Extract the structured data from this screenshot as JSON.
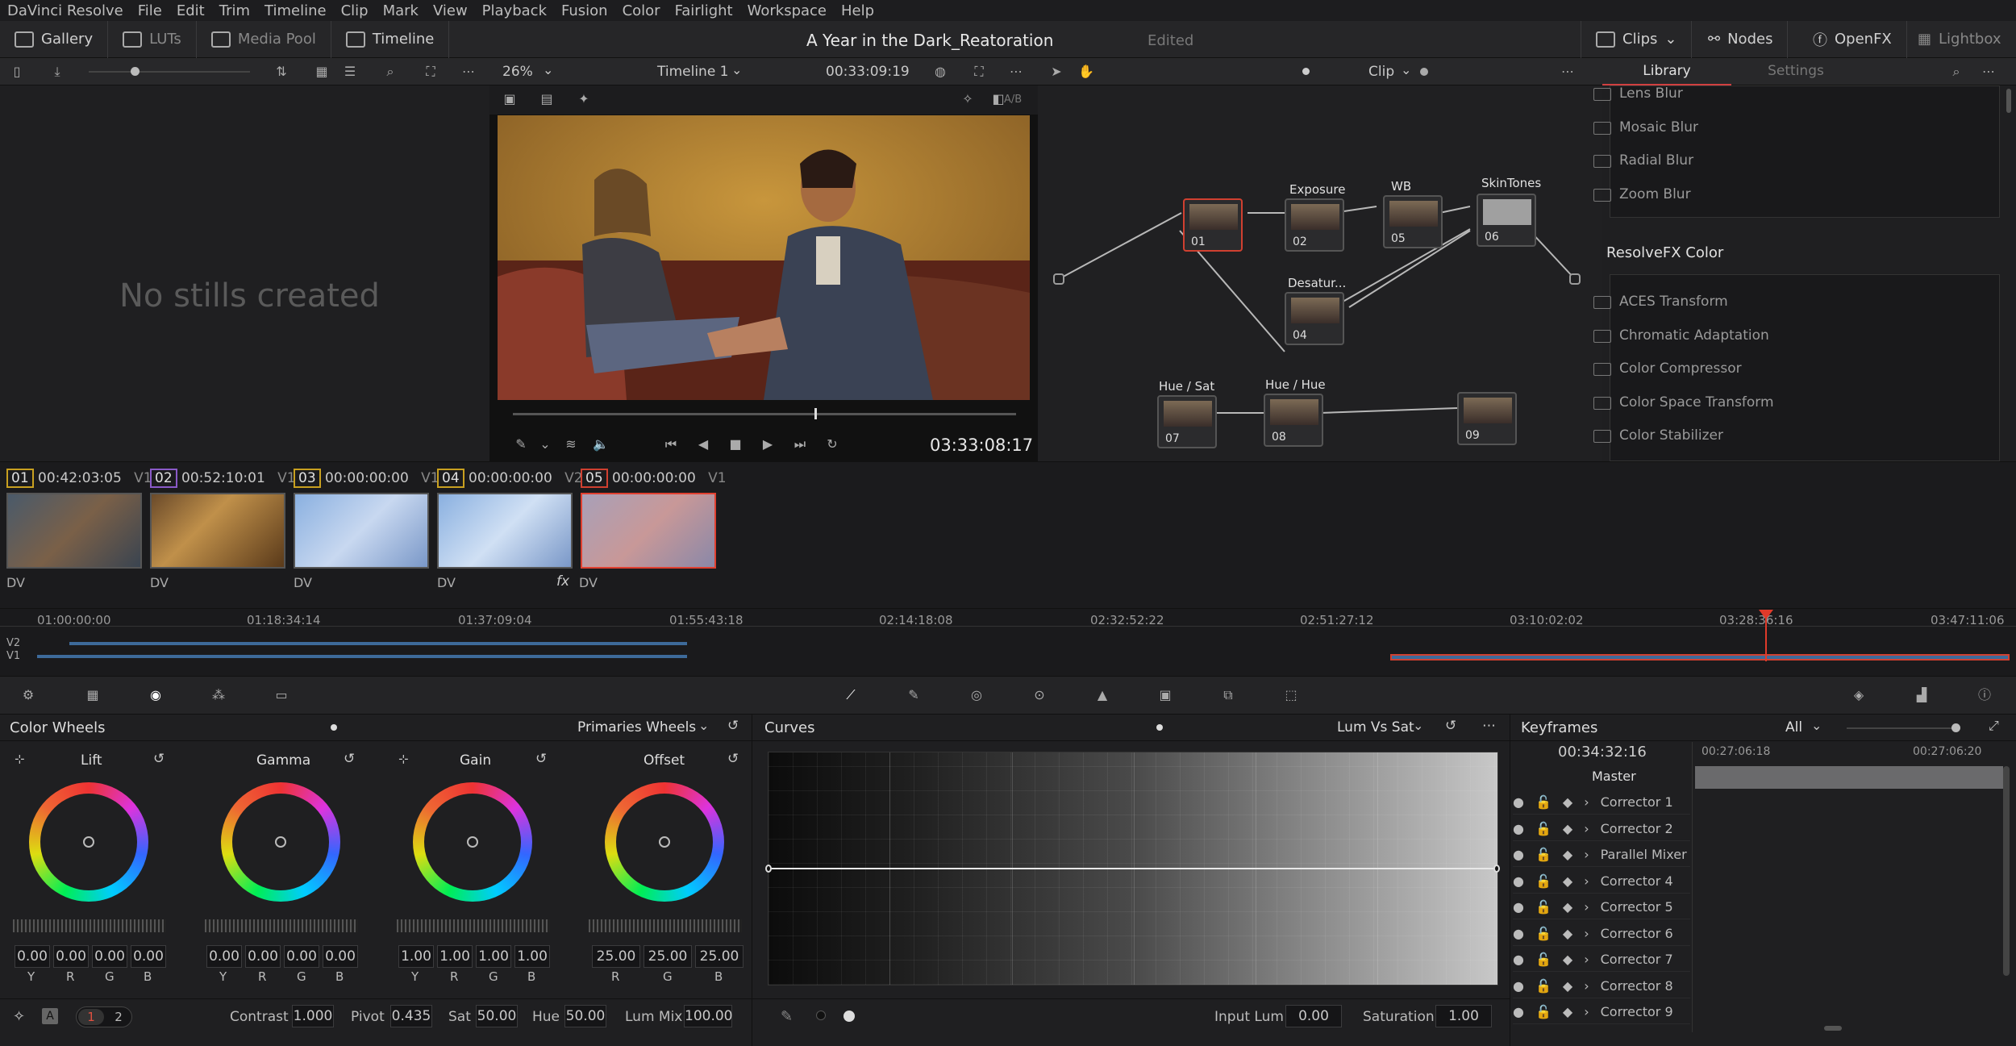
{
  "menu": [
    "DaVinci Resolve",
    "File",
    "Edit",
    "Trim",
    "Timeline",
    "Clip",
    "Mark",
    "View",
    "Playback",
    "Fusion",
    "Color",
    "Fairlight",
    "Workspace",
    "Help"
  ],
  "pages": {
    "gallery": "Gallery",
    "luts": "LUTs",
    "media_pool": "Media Pool",
    "timeline": "Timeline",
    "clips": "Clips",
    "nodes": "Nodes",
    "openfx": "OpenFX",
    "lightbox": "Lightbox"
  },
  "project": {
    "title": "A Year in the Dark_Reatoration",
    "status": "Edited"
  },
  "viewer": {
    "zoom": "26%",
    "timeline_name": "Timeline 1",
    "timecode": "00:33:09:19",
    "playhead_tc": "03:33:08:17",
    "ab": "A/B"
  },
  "gallery": {
    "empty_text": "No stills created"
  },
  "node_panel": {
    "mode": "Clip",
    "tab_library": "Library",
    "tab_settings": "Settings"
  },
  "nodes": [
    {
      "num": "01",
      "label": ""
    },
    {
      "num": "02",
      "label": "Exposure"
    },
    {
      "num": "05",
      "label": "WB"
    },
    {
      "num": "06",
      "label": "SkinTones"
    },
    {
      "num": "04",
      "label": "Desatur..."
    },
    {
      "num": "07",
      "label": "Hue / Sat"
    },
    {
      "num": "08",
      "label": "Hue / Hue"
    },
    {
      "num": "09",
      "label": ""
    }
  ],
  "fx_library": {
    "blur_items": [
      "Lens Blur",
      "Mosaic Blur",
      "Radial Blur",
      "Zoom Blur"
    ],
    "section": "ResolveFX Color",
    "color_items": [
      "ACES Transform",
      "Chromatic Adaptation",
      "Color Compressor",
      "Color Space Transform",
      "Color Stabilizer"
    ]
  },
  "clips": [
    {
      "num": "01",
      "tc": "00:42:03:05",
      "track": "V1",
      "codec": "DV"
    },
    {
      "num": "02",
      "tc": "00:52:10:01",
      "track": "V1",
      "codec": "DV"
    },
    {
      "num": "03",
      "tc": "00:00:00:00",
      "track": "V1",
      "codec": "DV"
    },
    {
      "num": "04",
      "tc": "00:00:00:00",
      "track": "V2",
      "codec": "DV"
    },
    {
      "num": "05",
      "tc": "00:00:00:00",
      "track": "V1",
      "codec": "DV"
    }
  ],
  "ruler": [
    "01:00:00:00",
    "01:18:34:14",
    "01:37:09:04",
    "01:55:43:18",
    "02:14:18:08",
    "02:32:52:22",
    "02:51:27:12",
    "03:10:02:02",
    "03:28:36:16",
    "03:47:11:06"
  ],
  "tracks": [
    "V2",
    "V1"
  ],
  "color_wheels": {
    "title": "Color Wheels",
    "mode": "Primaries Wheels",
    "wheels": [
      {
        "name": "Lift",
        "values": [
          "0.00",
          "0.00",
          "0.00",
          "0.00"
        ],
        "channels": [
          "Y",
          "R",
          "G",
          "B"
        ]
      },
      {
        "name": "Gamma",
        "values": [
          "0.00",
          "0.00",
          "0.00",
          "0.00"
        ],
        "channels": [
          "Y",
          "R",
          "G",
          "B"
        ]
      },
      {
        "name": "Gain",
        "values": [
          "1.00",
          "1.00",
          "1.00",
          "1.00"
        ],
        "channels": [
          "Y",
          "R",
          "G",
          "B"
        ]
      },
      {
        "name": "Offset",
        "values": [
          "25.00",
          "25.00",
          "25.00"
        ],
        "channels": [
          "R",
          "G",
          "B"
        ]
      }
    ],
    "contrast_label": "Contrast",
    "contrast": "1.000",
    "pivot_label": "Pivot",
    "pivot": "0.435",
    "sat_label": "Sat",
    "sat": "50.00",
    "hue_label": "Hue",
    "hue": "50.00",
    "lummix_label": "Lum Mix",
    "lummix": "100.00",
    "page1": "1",
    "page2": "2"
  },
  "curves": {
    "title": "Curves",
    "mode": "Lum Vs Sat",
    "input_lum_label": "Input Lum",
    "input_lum": "0.00",
    "saturation_label": "Saturation",
    "saturation": "1.00"
  },
  "keyframes": {
    "title": "Keyframes",
    "filter": "All",
    "timecode": "00:34:32:16",
    "t1": "00:27:06:18",
    "t2": "00:27:06:20",
    "master": "Master",
    "rows": [
      "Corrector 1",
      "Corrector 2",
      "Parallel Mixer",
      "Corrector 4",
      "Corrector 5",
      "Corrector 6",
      "Corrector 7",
      "Corrector 8",
      "Corrector 9"
    ]
  }
}
